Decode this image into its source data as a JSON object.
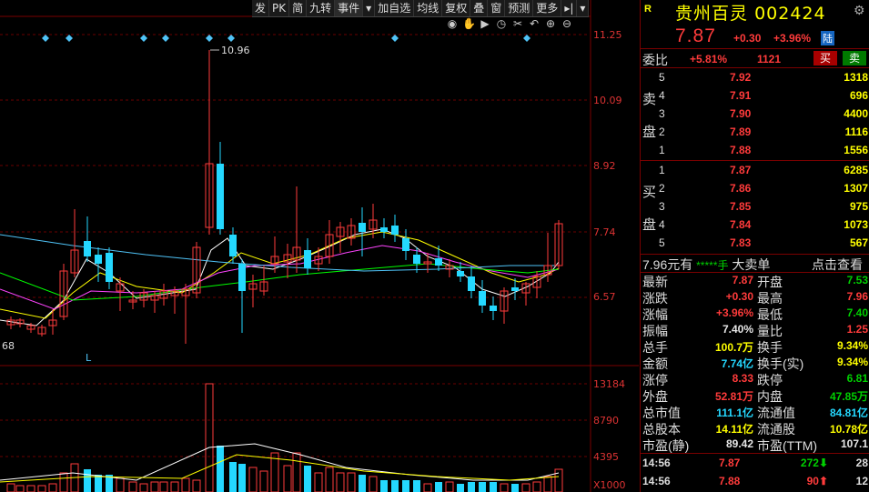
{
  "toolbar": {
    "items": [
      "发",
      "PK",
      "简",
      "九转",
      "事件",
      "▾",
      "加自选",
      "均线",
      "复权",
      "叠",
      "窗",
      "预测",
      "更多",
      "▸|",
      "▾"
    ]
  },
  "price_axis": [
    "11.25",
    "10.09",
    "8.92",
    "7.74",
    "6.57"
  ],
  "volume_axis": [
    "13184",
    "8790",
    "4395",
    "X1000"
  ],
  "chart_labels": {
    "high_marker": "10.96",
    "left_price": "68",
    "letter_l": "L"
  },
  "colors": {
    "up": "#ff3b3b",
    "down": "#24d8ff",
    "bg": "#000000",
    "accent_red": "#7a0000"
  },
  "quote": {
    "r_label": "R",
    "name": "贵州百灵",
    "code": "002424",
    "price": "7.87",
    "change": "+0.30",
    "change_pct": "+3.96%",
    "exchange_badge": "陆",
    "weibi_label": "委比",
    "weibi_value": "+5.81%",
    "weicha_value": "1121",
    "buy_btn": "买",
    "sell_btn": "卖"
  },
  "sell_orders": [
    {
      "level": "5",
      "price": "7.92",
      "vol": "1318"
    },
    {
      "level": "4",
      "price": "7.91",
      "vol": "696"
    },
    {
      "level": "3",
      "price": "7.90",
      "vol": "4400"
    },
    {
      "level": "2",
      "price": "7.89",
      "vol": "1116"
    },
    {
      "level": "1",
      "price": "7.88",
      "vol": "1556"
    }
  ],
  "sell_side_chars": [
    "卖",
    "盘"
  ],
  "buy_orders": [
    {
      "level": "1",
      "price": "7.87",
      "vol": "6285"
    },
    {
      "level": "2",
      "price": "7.86",
      "vol": "1307"
    },
    {
      "level": "3",
      "price": "7.85",
      "vol": "975"
    },
    {
      "level": "4",
      "price": "7.84",
      "vol": "1073"
    },
    {
      "level": "5",
      "price": "7.83",
      "vol": "567"
    }
  ],
  "buy_side_chars": [
    "买",
    "盘"
  ],
  "big_order": {
    "price_text": "7.96元有",
    "stars": "*****手",
    "label": "大卖单",
    "link": "点击查看"
  },
  "stats": [
    {
      "l": "最新",
      "v": "7.87",
      "vc": "red",
      "l2": "开盘",
      "v2": "7.53",
      "v2c": "green"
    },
    {
      "l": "涨跌",
      "v": "+0.30",
      "vc": "red",
      "l2": "最高",
      "v2": "7.96",
      "v2c": "red"
    },
    {
      "l": "涨幅",
      "v": "+3.96%",
      "vc": "red",
      "l2": "最低",
      "v2": "7.40",
      "v2c": "green"
    },
    {
      "l": "振幅",
      "v": "7.40%",
      "vc": "white",
      "l2": "量比",
      "v2": "1.25",
      "v2c": "red"
    },
    {
      "l": "总手",
      "v": "100.7万",
      "vc": "yellow",
      "l2": "换手",
      "v2": "9.34%",
      "v2c": "yellow"
    },
    {
      "l": "金额",
      "v": "7.74亿",
      "vc": "cyan",
      "l2": "换手(实)",
      "v2": "9.34%",
      "v2c": "yellow"
    },
    {
      "l": "涨停",
      "v": "8.33",
      "vc": "red",
      "l2": "跌停",
      "v2": "6.81",
      "v2c": "green"
    },
    {
      "l": "外盘",
      "v": "52.81万",
      "vc": "red",
      "l2": "内盘",
      "v2": "47.85万",
      "v2c": "green"
    },
    {
      "l": "总市值",
      "v": "111.1亿",
      "vc": "cyan",
      "l2": "流通值",
      "v2": "84.81亿",
      "v2c": "cyan"
    },
    {
      "l": "总股本",
      "v": "14.11亿",
      "vc": "yellow",
      "l2": "流通股",
      "v2": "10.78亿",
      "v2c": "yellow"
    },
    {
      "l": "市盈(静)",
      "v": "89.42",
      "vc": "white",
      "l2": "市盈(TTM)",
      "v2": "107.1",
      "v2c": "white"
    }
  ],
  "ticks": [
    {
      "time": "14:56",
      "price": "7.87",
      "vol": "272",
      "dir": "down",
      "num": "28"
    },
    {
      "time": "14:56",
      "price": "7.88",
      "vol": "90",
      "dir": "up",
      "num": "12"
    }
  ]
}
